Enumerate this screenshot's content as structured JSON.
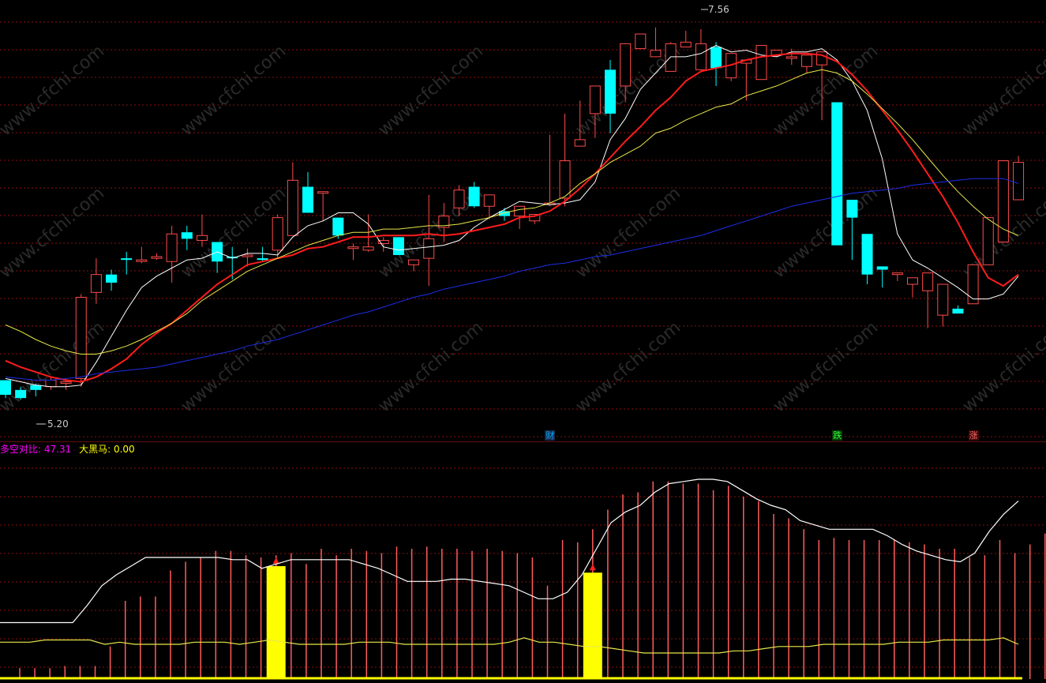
{
  "colors": {
    "background": "#000000",
    "up": "#ff4a4a",
    "down": "#00ffff",
    "ma5": "#ffffff",
    "ma10": "#ff1c1c",
    "ma20": "#e8e84a",
    "ma60": "#1c2ee8",
    "bar": "#ff5c5c",
    "signal": "#ffff00",
    "ratio_label": "#ff00ff",
    "horse_label": "#ffff00",
    "grid": "#8a0f0f"
  },
  "watermark": "www.cfchi.com",
  "main_panel": {
    "high_label": "7.56",
    "low_label": "5.20",
    "markers": [
      {
        "text": "财",
        "bar": 36,
        "color": "#00aaff",
        "bg": "#1a2a4a"
      },
      {
        "text": "跌",
        "bar": 55,
        "color": "#33ff33",
        "bg": "#0a3a0a"
      },
      {
        "text": "涨",
        "bar": 64,
        "color": "#ff6666",
        "bg": "#3a0a0a"
      }
    ]
  },
  "indicator_panel": {
    "ratio_name": "多空对比:",
    "ratio_value": "47.31",
    "horse_name": "大黑马:",
    "horse_value": "0.00"
  },
  "chart_data": [
    {
      "type": "candlestick",
      "title": "",
      "price_range": [
        5.2,
        7.56
      ],
      "candles_ohlc": [
        [
          5.31,
          5.31,
          5.2,
          5.22
        ],
        [
          5.25,
          5.27,
          5.19,
          5.2
        ],
        [
          5.28,
          5.29,
          5.21,
          5.25
        ],
        [
          5.27,
          5.33,
          5.25,
          5.31
        ],
        [
          5.3,
          5.32,
          5.25,
          5.3
        ],
        [
          5.32,
          5.84,
          5.27,
          5.82
        ],
        [
          5.85,
          6.06,
          5.78,
          5.96
        ],
        [
          5.96,
          5.99,
          5.86,
          5.91
        ],
        [
          6.06,
          6.1,
          5.96,
          6.05
        ],
        [
          6.05,
          6.13,
          6.03,
          6.05
        ],
        [
          6.06,
          6.09,
          6.05,
          6.07
        ],
        [
          6.04,
          6.26,
          5.91,
          6.21
        ],
        [
          6.22,
          6.26,
          6.11,
          6.18
        ],
        [
          6.17,
          6.33,
          6.13,
          6.2
        ],
        [
          6.16,
          6.14,
          5.97,
          6.04
        ],
        [
          6.07,
          6.13,
          5.93,
          6.06
        ],
        [
          6.07,
          6.12,
          6.01,
          6.08
        ],
        [
          6.06,
          6.13,
          6.04,
          6.05
        ],
        [
          6.11,
          6.33,
          6.06,
          6.31
        ],
        [
          6.2,
          6.65,
          6.2,
          6.54
        ],
        [
          6.5,
          6.59,
          6.4,
          6.34
        ],
        [
          6.47,
          6.43,
          6.29,
          6.47
        ],
        [
          6.31,
          6.31,
          6.18,
          6.2
        ],
        [
          6.12,
          6.15,
          6.05,
          6.13
        ],
        [
          6.11,
          6.33,
          6.1,
          6.13
        ],
        [
          6.15,
          6.19,
          6.1,
          6.17
        ],
        [
          6.19,
          6.09,
          6.15,
          6.08
        ],
        [
          6.02,
          5.99,
          5.98,
          6.05
        ],
        [
          6.06,
          6.45,
          5.89,
          6.18
        ],
        [
          6.25,
          6.4,
          6.16,
          6.32
        ],
        [
          6.37,
          6.51,
          6.32,
          6.48
        ],
        [
          6.5,
          6.53,
          6.37,
          6.38
        ],
        [
          6.38,
          6.43,
          6.3,
          6.45
        ],
        [
          6.35,
          6.37,
          6.29,
          6.32
        ],
        [
          6.32,
          6.35,
          6.24,
          6.38
        ],
        [
          6.29,
          6.32,
          6.27,
          6.33
        ],
        [
          6.39,
          6.82,
          6.38,
          6.4
        ],
        [
          6.43,
          6.95,
          6.38,
          6.66
        ],
        [
          6.75,
          7.03,
          6.75,
          6.79
        ],
        [
          6.95,
          7.08,
          6.8,
          7.12
        ],
        [
          7.22,
          7.28,
          6.83,
          6.95
        ],
        [
          7.12,
          7.37,
          7.02,
          7.38
        ],
        [
          7.35,
          7.36,
          7.36,
          7.44
        ],
        [
          7.3,
          7.45,
          7.48,
          7.34
        ],
        [
          7.21,
          7.39,
          7.35,
          7.38
        ],
        [
          7.36,
          7.46,
          7.44,
          7.39
        ],
        [
          7.22,
          7.47,
          7.26,
          7.38
        ],
        [
          7.36,
          7.39,
          7.12,
          7.23
        ],
        [
          7.17,
          7.23,
          7.15,
          7.32
        ],
        [
          7.26,
          7.26,
          7.03,
          7.28
        ],
        [
          7.16,
          7.33,
          7.24,
          7.37
        ],
        [
          7.31,
          7.34,
          7.3,
          7.34
        ],
        [
          7.29,
          7.35,
          7.25,
          7.3
        ],
        [
          7.24,
          7.28,
          7.2,
          7.31
        ],
        [
          7.25,
          6.99,
          6.91,
          7.33
        ],
        [
          7.02,
          6.35,
          6.21,
          6.14
        ],
        [
          6.42,
          6.08,
          6.05,
          6.31
        ],
        [
          6.21,
          5.9,
          6.0,
          5.96
        ],
        [
          6.01,
          5.98,
          5.88,
          5.99
        ],
        [
          5.96,
          5.96,
          5.92,
          5.97
        ],
        [
          5.9,
          5.86,
          5.82,
          5.94
        ],
        [
          5.86,
          5.8,
          5.63,
          5.97
        ],
        [
          5.71,
          5.74,
          5.64,
          5.9
        ],
        [
          5.75,
          5.72,
          5.77,
          5.72
        ],
        [
          5.78,
          6.02,
          5.84,
          6.02
        ],
        [
          6.02,
          6.21,
          6.07,
          6.31
        ],
        [
          6.16,
          6.43,
          6.28,
          6.66
        ],
        [
          6.42,
          6.69,
          6.52,
          6.65
        ]
      ],
      "series": [
        {
          "name": "",
          "color": "#ffffff",
          "values": [
            5.32,
            5.3,
            5.28,
            5.27,
            5.27,
            5.28,
            5.42,
            5.58,
            5.74,
            5.88,
            5.95,
            6.0,
            6.05,
            6.06,
            6.1,
            6.06,
            6.09,
            6.09,
            6.08,
            6.19,
            6.26,
            6.29,
            6.34,
            6.34,
            6.27,
            6.13,
            6.11,
            6.12,
            6.13,
            6.14,
            6.17,
            6.25,
            6.31,
            6.36,
            6.41,
            6.4,
            6.39,
            6.4,
            6.42,
            6.53,
            6.79,
            6.92,
            7.1,
            7.2,
            7.3,
            7.3,
            7.32,
            7.37,
            7.33,
            7.34,
            7.31,
            7.3,
            7.33,
            7.33,
            7.35,
            7.28,
            7.15,
            6.97,
            6.67,
            6.21,
            6.05,
            6.0,
            5.94,
            5.88,
            5.81,
            5.81,
            5.84,
            5.95
          ]
        },
        {
          "name": "",
          "color": "#ff1c1c",
          "values": [
            5.43,
            5.39,
            5.36,
            5.33,
            5.31,
            5.3,
            5.33,
            5.38,
            5.44,
            5.53,
            5.6,
            5.66,
            5.74,
            5.82,
            5.9,
            5.96,
            6.02,
            6.04,
            6.06,
            6.08,
            6.12,
            6.13,
            6.16,
            6.19,
            6.19,
            6.2,
            6.2,
            6.2,
            6.21,
            6.2,
            6.21,
            6.23,
            6.25,
            6.27,
            6.31,
            6.32,
            6.35,
            6.41,
            6.49,
            6.58,
            6.68,
            6.78,
            6.87,
            6.97,
            7.05,
            7.15,
            7.21,
            7.23,
            7.25,
            7.28,
            7.3,
            7.31,
            7.32,
            7.32,
            7.31,
            7.27,
            7.19,
            7.09,
            6.97,
            6.85,
            6.72,
            6.58,
            6.44,
            6.28,
            6.1,
            5.94,
            5.89,
            5.96
          ]
        },
        {
          "name": "",
          "color": "#e8e84a",
          "values": [
            5.65,
            5.61,
            5.56,
            5.52,
            5.49,
            5.47,
            5.47,
            5.49,
            5.52,
            5.56,
            5.61,
            5.66,
            5.72,
            5.8,
            5.86,
            5.92,
            5.98,
            6.02,
            6.06,
            6.1,
            6.14,
            6.17,
            6.2,
            6.22,
            6.22,
            6.24,
            6.24,
            6.25,
            6.26,
            6.26,
            6.27,
            6.29,
            6.31,
            6.34,
            6.36,
            6.37,
            6.4,
            6.44,
            6.52,
            6.58,
            6.65,
            6.7,
            6.75,
            6.83,
            6.86,
            6.91,
            6.95,
            6.99,
            7.01,
            7.06,
            7.09,
            7.12,
            7.16,
            7.2,
            7.22,
            7.2,
            7.15,
            7.07,
            6.98,
            6.89,
            6.79,
            6.68,
            6.57,
            6.47,
            6.38,
            6.3,
            6.24,
            6.2
          ]
        },
        {
          "name": "",
          "color": "#1c2ee8",
          "values": [
            5.33,
            5.32,
            5.31,
            5.31,
            5.32,
            5.33,
            5.35,
            5.36,
            5.37,
            5.38,
            5.39,
            5.41,
            5.43,
            5.45,
            5.47,
            5.49,
            5.52,
            5.54,
            5.56,
            5.59,
            5.62,
            5.65,
            5.68,
            5.71,
            5.73,
            5.76,
            5.79,
            5.82,
            5.84,
            5.87,
            5.89,
            5.91,
            5.93,
            5.95,
            5.98,
            6.0,
            6.02,
            6.03,
            6.05,
            6.07,
            6.08,
            6.1,
            6.12,
            6.14,
            6.16,
            6.18,
            6.2,
            6.23,
            6.26,
            6.29,
            6.32,
            6.35,
            6.38,
            6.4,
            6.42,
            6.44,
            6.46,
            6.47,
            6.48,
            6.49,
            6.51,
            6.52,
            6.53,
            6.54,
            6.55,
            6.55,
            6.55,
            6.52
          ]
        }
      ]
    },
    {
      "type": "bar",
      "title": "",
      "ylim": [
        0,
        100
      ],
      "series": [
        {
          "name": "",
          "color": "#ff5c5c",
          "values": [
            5,
            5,
            5,
            6,
            6,
            6,
            15,
            36,
            38,
            38,
            50,
            54,
            56,
            59,
            59,
            57,
            56,
            57,
            58,
            53,
            60,
            57,
            60,
            59,
            58,
            61,
            60,
            61,
            60,
            60,
            59,
            60,
            59,
            58,
            56,
            43,
            64,
            63,
            69,
            78,
            85,
            86,
            91,
            91,
            90,
            90,
            87,
            89,
            84,
            82,
            76,
            74,
            69,
            64,
            65,
            64,
            64,
            64,
            64,
            63,
            62,
            60,
            60,
            56,
            57,
            64,
            58,
            62,
            67
          ]
        },
        {
          "name": "",
          "color": "#ffffff",
          "values": [
            26,
            26,
            26,
            26,
            26,
            26,
            34,
            43,
            48,
            52,
            56,
            56,
            56,
            56,
            56,
            56,
            55,
            55,
            51,
            53,
            55,
            55,
            55,
            55,
            55,
            53,
            51,
            48,
            45,
            45,
            45,
            46,
            46,
            45,
            44,
            43,
            40,
            37,
            37,
            40,
            48,
            60,
            72,
            77,
            80,
            86,
            90,
            91,
            92,
            92,
            91,
            87,
            83,
            80,
            78,
            73,
            71,
            69,
            69,
            69,
            69,
            66,
            62,
            59,
            57,
            55,
            54,
            58,
            68,
            76,
            82
          ]
        },
        {
          "name": "",
          "color": "#e8e84a",
          "values": [
            17,
            17,
            17,
            18,
            18,
            18,
            18,
            16,
            17,
            16,
            16,
            16,
            16,
            17,
            17,
            17,
            16,
            17,
            18,
            17,
            16,
            16,
            16,
            16,
            17,
            17,
            17,
            16,
            16,
            16,
            16,
            16,
            16,
            16,
            17,
            19,
            17,
            17,
            16,
            15,
            15,
            14,
            13,
            12,
            12,
            12,
            12,
            12,
            12,
            13,
            13,
            14,
            15,
            15,
            15,
            16,
            16,
            16,
            16,
            16,
            17,
            17,
            17,
            18,
            18,
            18,
            18,
            19,
            16
          ]
        },
        {
          "name": "",
          "color": "#ffff00",
          "values": [
            2,
            2,
            2,
            2,
            2,
            2,
            2,
            2,
            2,
            2,
            2,
            2,
            2,
            2,
            2,
            2,
            2,
            2,
            2,
            2,
            2,
            2,
            2,
            2,
            2,
            2,
            2,
            2,
            2,
            2,
            2,
            2,
            2,
            2,
            2,
            2,
            2,
            2,
            2,
            2,
            2,
            2,
            2,
            2,
            2,
            2,
            2,
            2,
            2,
            2,
            2,
            2,
            2,
            2,
            2,
            2,
            2,
            2,
            2,
            2,
            2,
            2,
            2,
            2,
            2,
            2,
            2,
            2,
            2,
            2,
            2
          ]
        },
        {
          "name": "",
          "color": "#ffff00",
          "signal_bars": [
            17,
            38
          ],
          "values": [
            52,
            49
          ]
        }
      ]
    }
  ]
}
